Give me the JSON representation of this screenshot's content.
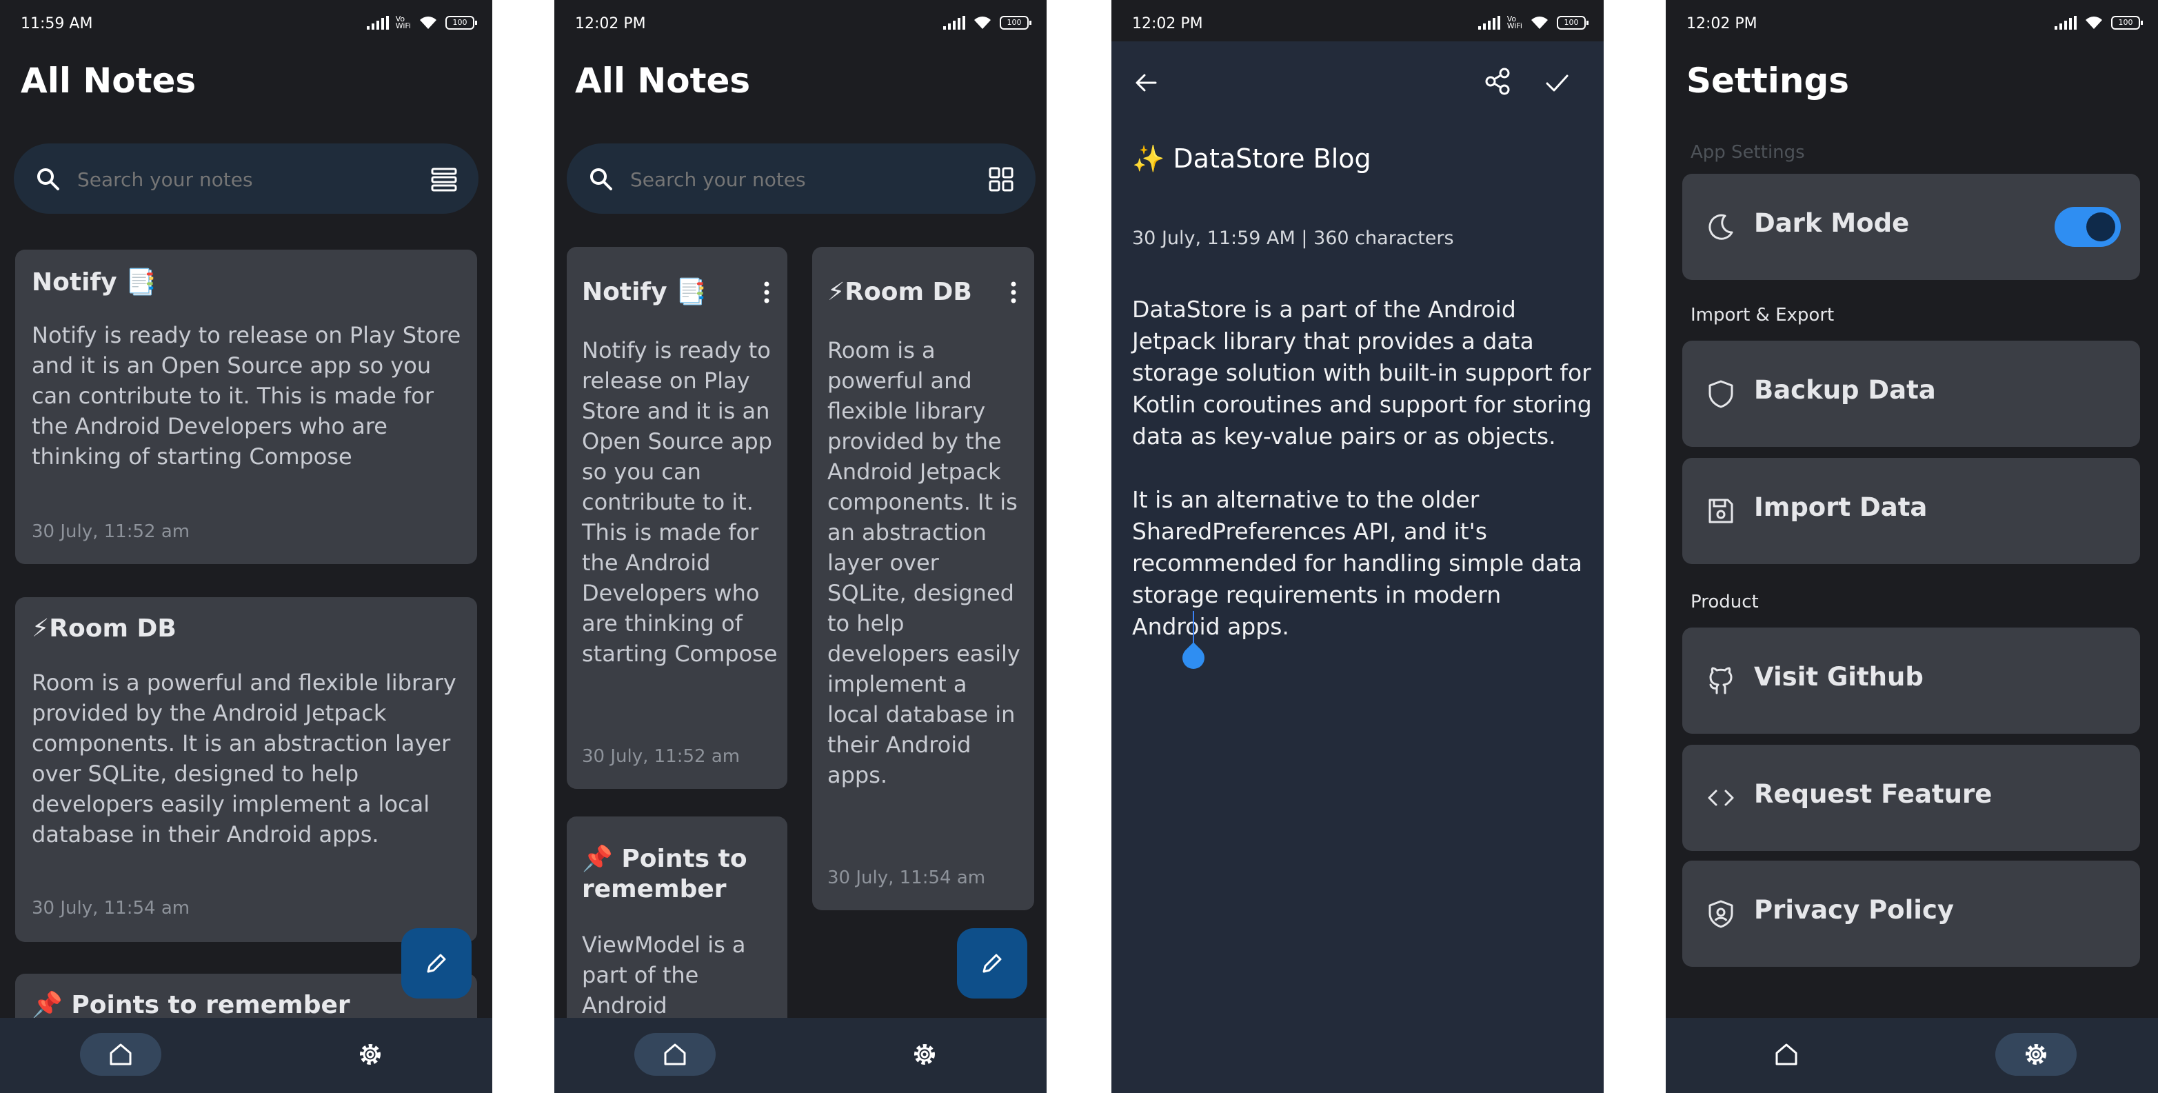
{
  "status": {
    "s1_time": "11:59 AM",
    "s2_time": "12:02 PM",
    "s3_time": "12:02 PM",
    "s4_time": "12:02 PM",
    "volte": "Vo\nWiFi",
    "battery": "100"
  },
  "notes_screen": {
    "title": "All Notes",
    "search_placeholder": "Search your notes"
  },
  "notes": [
    {
      "title": "Notify 📑",
      "body": "Notify is ready to release on Play Store and it is an Open Source app so you can contribute to it. This is made for the Android Developers who are thinking of starting Compose",
      "date": "30 July, 11:52 am"
    },
    {
      "title": "⚡Room DB",
      "body": "Room is a powerful and flexible library provided by the Android Jetpack components. It is an abstraction layer over SQLite, designed to help developers easily implement a local database in their Android apps.",
      "date": "30 July, 11:54 am"
    },
    {
      "title": "📌 Points to remember",
      "title_grid": "📌 Points to\nremember",
      "body": "ViewModel is a part of the Android"
    }
  ],
  "editor": {
    "title": "✨ DataStore Blog",
    "meta": "30 July, 11:59 AM   |  360 characters",
    "body": "DataStore is a part of the Android Jetpack library that provides a data storage solution with built-in support for Kotlin coroutines and support for storing data as key-value pairs or as objects.\n\nIt is an alternative to the older SharedPreferences API, and it's recommended for handling simple data storage requirements in modern Android apps."
  },
  "settings": {
    "title": "Settings",
    "app_settings_label": "App Settings",
    "dark_mode_label": "Dark Mode",
    "dark_mode_on": true,
    "import_export_label": "Import & Export",
    "backup_label": "Backup Data",
    "import_label": "Import Data",
    "product_label": "Product",
    "github_label": "Visit Github",
    "request_label": "Request Feature",
    "privacy_label": "Privacy Policy"
  },
  "colors": {
    "background": "#1c1d21",
    "card": "#3b3e45",
    "search": "#1f2c3b",
    "fab": "#0e4f8a",
    "accent": "#2f8ef2",
    "bottom_nav": "#232b38",
    "editor_background": "#232b3a"
  }
}
